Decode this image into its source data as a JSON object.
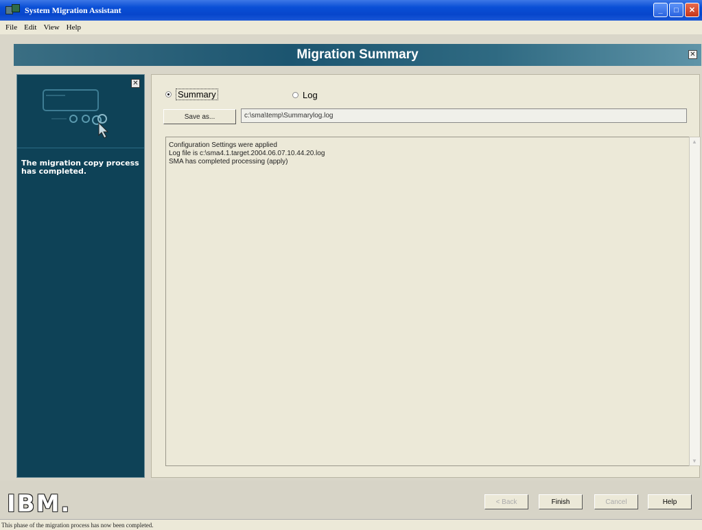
{
  "window": {
    "title": "System Migration Assistant"
  },
  "window_controls": {
    "minimize": "_",
    "maximize": "□",
    "close": "✕"
  },
  "menu": [
    "File",
    "Edit",
    "View",
    "Help"
  ],
  "banner": {
    "title": "Migration Summary",
    "close": "✕"
  },
  "left_panel": {
    "close": "✕",
    "message": "The migration copy process has completed."
  },
  "options": {
    "summary_label": "Summary",
    "log_label": "Log",
    "selected": "Summary"
  },
  "save_as": {
    "button_label": "Save as...",
    "path_value": "c:\\sma\\temp\\Summarylog.log"
  },
  "log_lines": [
    "Configuration Settings were applied",
    "Log file is  c:\\sma4.1.target.2004.06.07.10.44.20.log",
    "SMA has completed processing (apply)"
  ],
  "scroll": {
    "up": "▲",
    "down": "▼"
  },
  "logo": "IBM.",
  "nav": {
    "back": "< Back",
    "finish": "Finish",
    "cancel": "Cancel",
    "help": "Help"
  },
  "status": "This phase of the migration process has now been completed."
}
